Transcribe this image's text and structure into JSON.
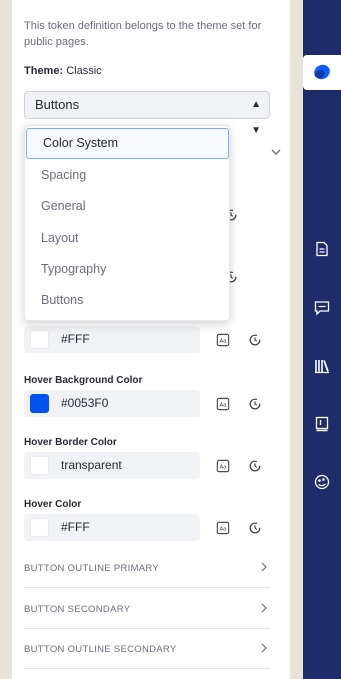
{
  "panel": {
    "info_text": "This token definition belongs to the theme set for public pages.",
    "theme_label": "Theme:",
    "theme_value": "Classic",
    "category_select": {
      "selected": "Buttons"
    },
    "dropdown_options": [
      "Color System",
      "Spacing",
      "General",
      "Layout",
      "Typography",
      "Buttons"
    ],
    "fields": [
      {
        "label": "",
        "value": "#FFF",
        "swatch_color": "#ffffff"
      },
      {
        "label": "Hover Background Color",
        "value": "#0053F0",
        "swatch_color": "#0053F0"
      },
      {
        "label": "Hover Border Color",
        "value": "transparent",
        "swatch_color": "#ffffff"
      },
      {
        "label": "Hover Color",
        "value": "#FFF",
        "swatch_color": "#ffffff"
      }
    ],
    "sections": [
      "BUTTON OUTLINE PRIMARY",
      "BUTTON SECONDARY",
      "BUTTON OUTLINE SECONDARY"
    ]
  },
  "navbar": {
    "background": "#1f2c6b",
    "icons": [
      "product-logo-icon",
      "page-icon",
      "message-icon",
      "library-icon",
      "book-icon",
      "theme-icon"
    ]
  }
}
